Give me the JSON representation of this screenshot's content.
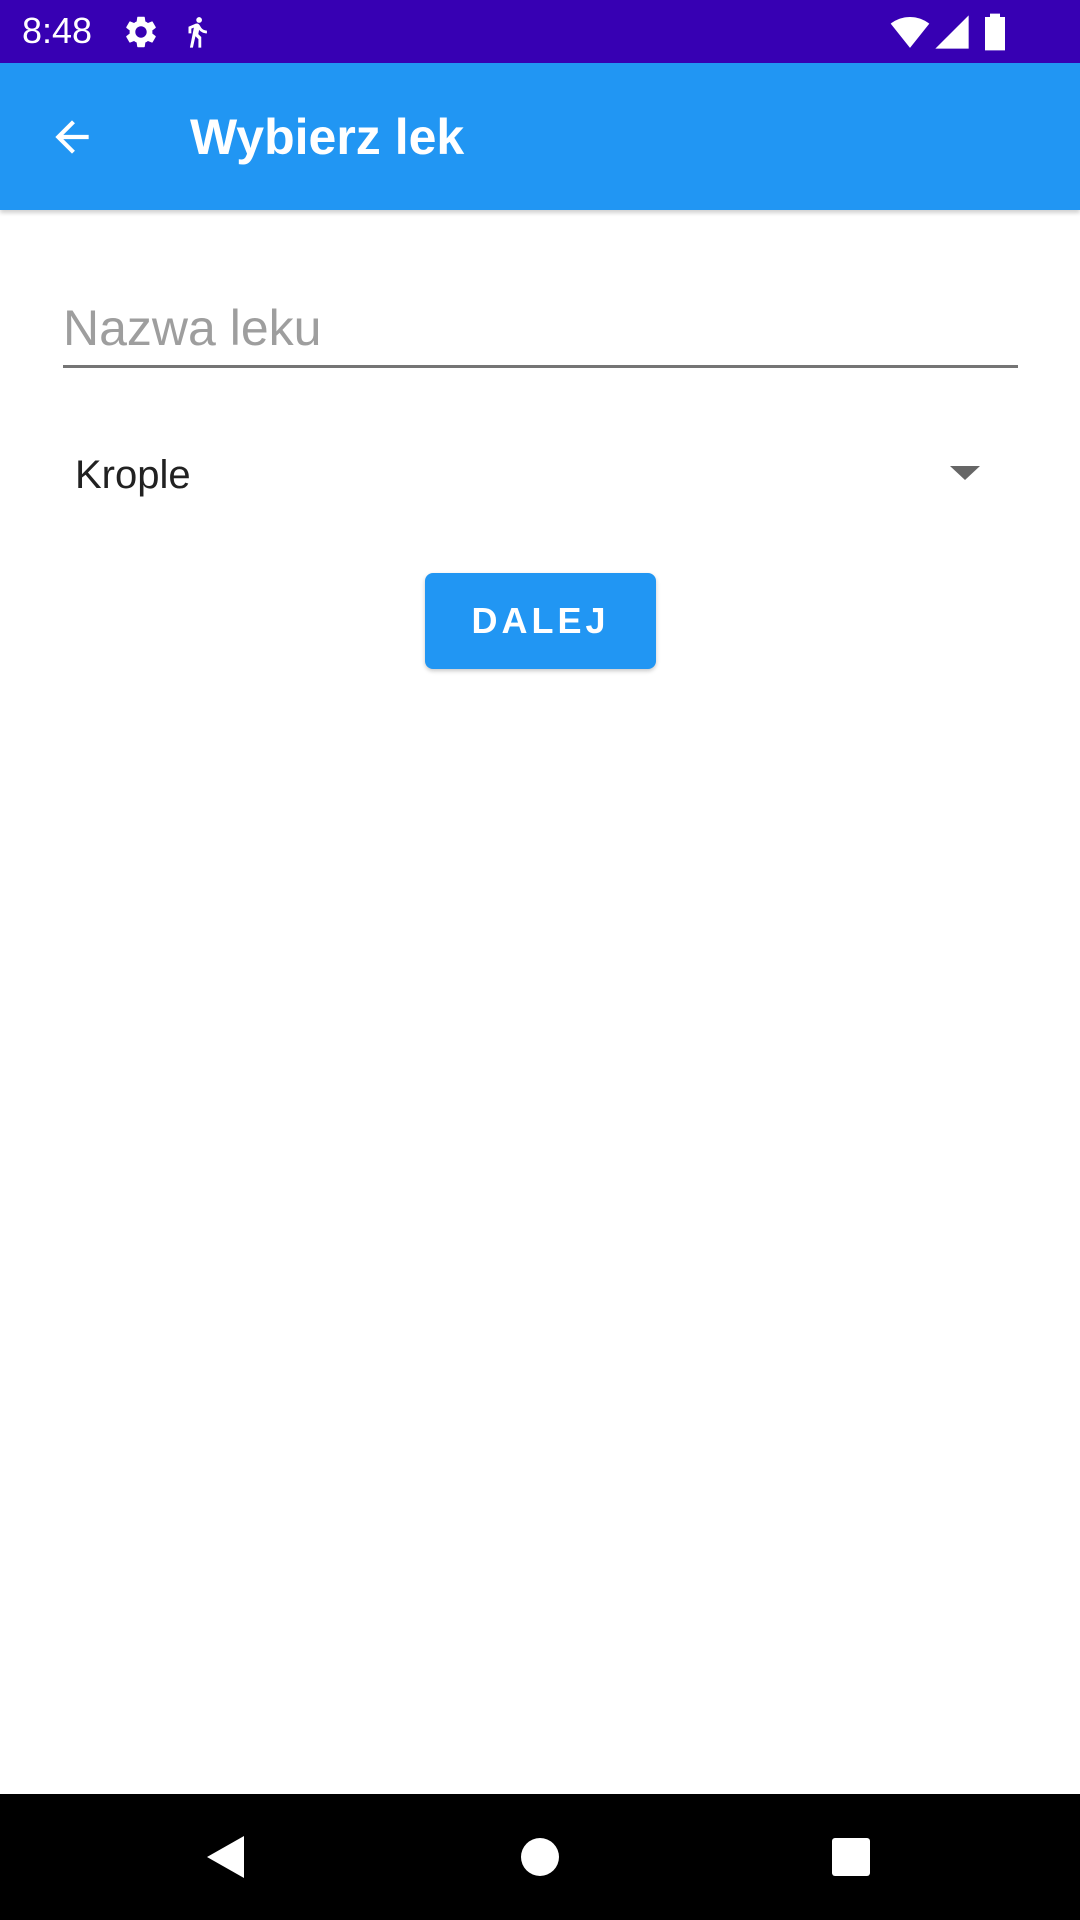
{
  "status_bar": {
    "time": "8:48",
    "background": "#3700b3",
    "icons": [
      "gear-icon",
      "walking-person-icon",
      "wifi-icon",
      "cell-signal-icon",
      "battery-icon"
    ]
  },
  "app_bar": {
    "title": "Wybierz lek",
    "background": "#2196f3",
    "back_icon": "arrow-left-icon"
  },
  "form": {
    "name_placeholder": "Nazwa leku",
    "name_value": "",
    "type_selected": "Krople",
    "next_label": "DALEJ",
    "accent": "#2196f3"
  },
  "nav_bar": {
    "icons": [
      "back-triangle-icon",
      "home-circle-icon",
      "recents-square-icon"
    ]
  }
}
